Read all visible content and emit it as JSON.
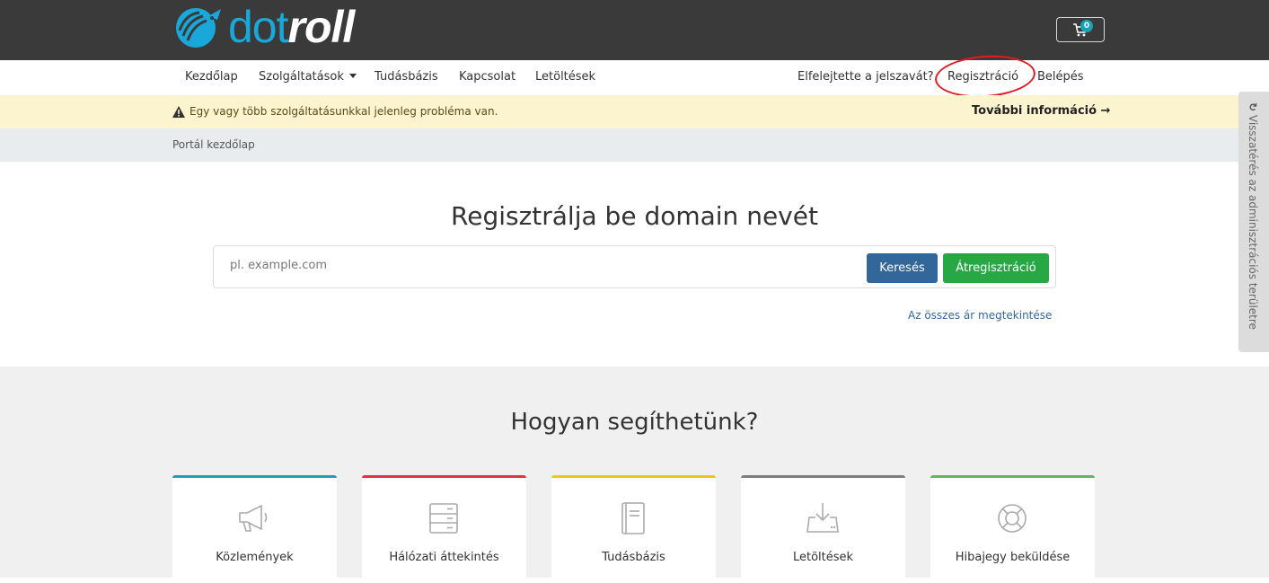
{
  "brand": {
    "part1": "dot",
    "part2": "roll"
  },
  "cart": {
    "count": "0"
  },
  "nav": {
    "left": [
      "Kezdőlap",
      "Szolgáltatások",
      "Tudásbázis",
      "Kapcsolat",
      "Letöltések"
    ],
    "forgot": "Elfelejtette a jelszavát?",
    "register": "Regisztráció",
    "login": "Belépés"
  },
  "alert": {
    "message": "Egy vagy több szolgáltatásunkkal jelenleg probléma van.",
    "more": "További információ →"
  },
  "breadcrumb": "Portál kezdőlap",
  "domain": {
    "title": "Regisztrálja be domain nevét",
    "placeholder": "pl. example.com",
    "search": "Keresés",
    "transfer": "Átregisztráció",
    "all_prices": "Az összes ár megtekintése"
  },
  "help": {
    "title": "Hogyan segíthetünk?",
    "cards": [
      {
        "label": "Közlemények",
        "icon": "megaphone-icon",
        "color": "#17a2b8"
      },
      {
        "label": "Hálózati áttekintés",
        "icon": "server-icon",
        "color": "#dc3545"
      },
      {
        "label": "Tudásbázis",
        "icon": "book-icon",
        "color": "#f0c419"
      },
      {
        "label": "Letöltések",
        "icon": "download-icon",
        "color": "#7d7d7d"
      },
      {
        "label": "Hibajegy beküldése",
        "icon": "lifebuoy-icon",
        "color": "#5cb85c"
      }
    ]
  },
  "admin_tab": "Visszatérés az adminisztrációs területre",
  "colors": {
    "header_bg": "#3a3a3a",
    "brand_blue": "#1aa7d9",
    "alert_bg": "#fcf3cf",
    "search_btn": "#336699",
    "transfer_btn": "#28a745"
  }
}
